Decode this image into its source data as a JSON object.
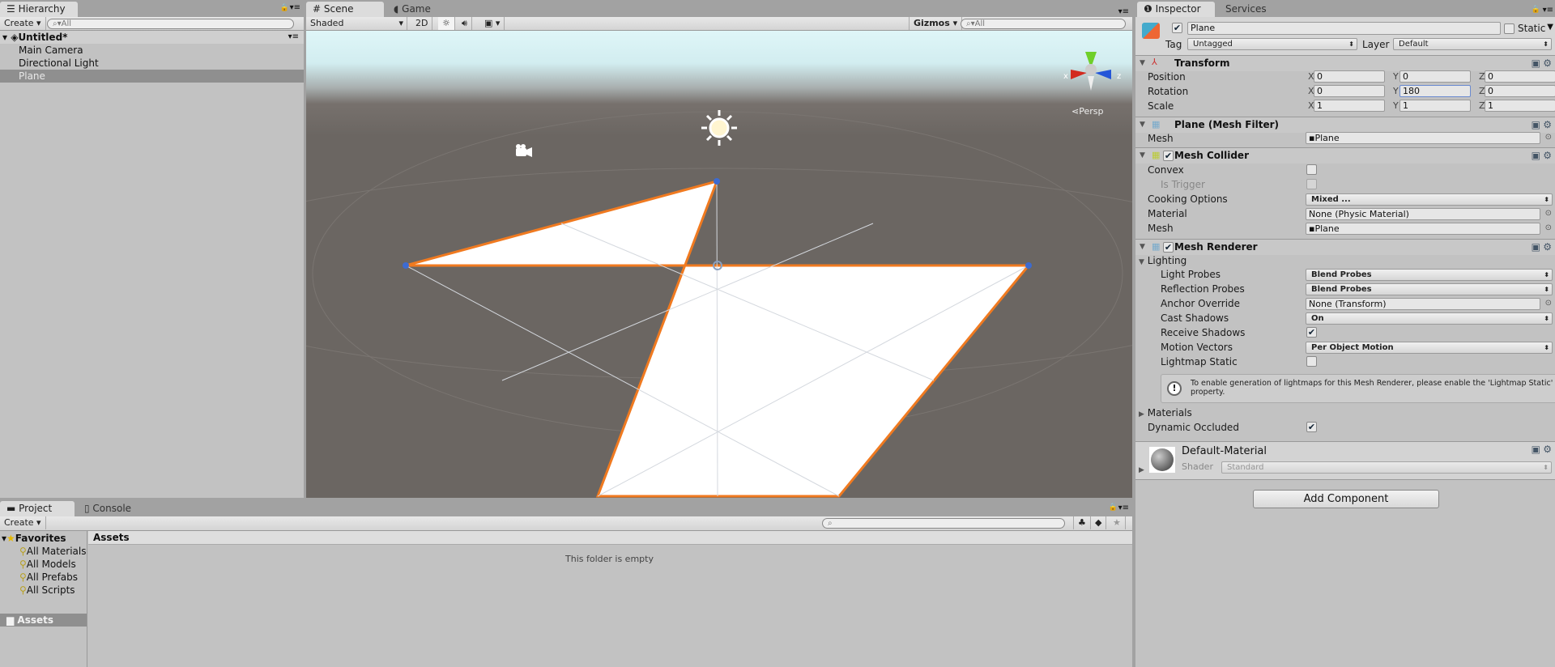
{
  "hierarchy": {
    "tab": "Hierarchy",
    "create": "Create",
    "search_placeholder": "All",
    "scene": "Untitled*",
    "items": [
      "Main Camera",
      "Directional Light",
      "Plane"
    ],
    "selected": "Plane"
  },
  "scene": {
    "tabs": [
      "Scene",
      "Game"
    ],
    "shading": "Shaded",
    "mode_2d": "2D",
    "gizmos": "Gizmos",
    "search_placeholder": "All",
    "persp": "Persp",
    "axis_x": "x",
    "axis_z": "z",
    "sky_color": "#dff6f8",
    "ground_color": "#6b6662",
    "selection_color": "#f07a20"
  },
  "inspector": {
    "tabs": [
      "Inspector",
      "Services"
    ],
    "object_name": "Plane",
    "active": true,
    "static_label": "Static",
    "static": false,
    "tag_label": "Tag",
    "tag": "Untagged",
    "layer_label": "Layer",
    "layer": "Default",
    "transform": {
      "title": "Transform",
      "rows": [
        {
          "label": "Position",
          "x": "0",
          "y": "0",
          "z": "0"
        },
        {
          "label": "Rotation",
          "x": "0",
          "y": "180",
          "z": "0"
        },
        {
          "label": "Scale",
          "x": "1",
          "y": "1",
          "z": "1"
        }
      ],
      "axes": [
        "X",
        "Y",
        "Z"
      ]
    },
    "mesh_filter": {
      "title": "Plane (Mesh Filter)",
      "mesh_label": "Mesh",
      "mesh": "Plane"
    },
    "mesh_collider": {
      "title": "Mesh Collider",
      "enabled": true,
      "convex_label": "Convex",
      "convex": false,
      "trigger_label": "Is Trigger",
      "trigger": false,
      "cooking_label": "Cooking Options",
      "cooking": "Mixed ...",
      "material_label": "Material",
      "material": "None (Physic Material)",
      "mesh_label": "Mesh",
      "mesh": "Plane"
    },
    "mesh_renderer": {
      "title": "Mesh Renderer",
      "enabled": true,
      "lighting": "Lighting",
      "light_probes_label": "Light Probes",
      "light_probes": "Blend Probes",
      "reflection_label": "Reflection Probes",
      "reflection": "Blend Probes",
      "anchor_label": "Anchor Override",
      "anchor": "None (Transform)",
      "cast_label": "Cast Shadows",
      "cast": "On",
      "receive_label": "Receive Shadows",
      "receive": true,
      "motion_label": "Motion Vectors",
      "motion": "Per Object Motion",
      "lightmap_label": "Lightmap Static",
      "lightmap": false,
      "help": "To enable generation of lightmaps for this Mesh Renderer, please enable the 'Lightmap Static' property.",
      "materials": "Materials",
      "occluded_label": "Dynamic Occluded",
      "occluded": true
    },
    "material": {
      "name": "Default-Material",
      "shader_label": "Shader",
      "shader": "Standard"
    },
    "add_component": "Add Component"
  },
  "project": {
    "tabs": [
      "Project",
      "Console"
    ],
    "create": "Create",
    "favorites": "Favorites",
    "favorite_items": [
      "All Materials",
      "All Models",
      "All Prefabs",
      "All Scripts"
    ],
    "assets": "Assets",
    "assets_header": "Assets",
    "empty": "This folder is empty"
  }
}
